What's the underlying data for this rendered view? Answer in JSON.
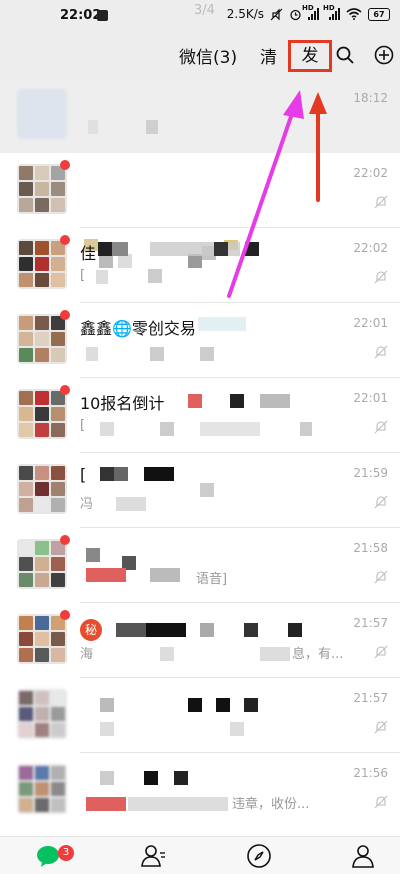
{
  "status_bar": {
    "time": "22:02",
    "page_indicator": "3/4",
    "net_speed": "2.5K/s",
    "sim1": "HD",
    "sim2": "HD",
    "battery": "67"
  },
  "header": {
    "title": "微信(3)",
    "clear_label": "清",
    "send_label": "发",
    "search_icon": "search-icon",
    "add_icon": "plus-circle-icon"
  },
  "chats": [
    {
      "name": "",
      "preview": "",
      "time": "18:12",
      "pinned": true,
      "unread_dot": false,
      "muted": false
    },
    {
      "name": "",
      "preview": "",
      "time": "22:02",
      "pinned": false,
      "unread_dot": true,
      "muted": true
    },
    {
      "name": "佳",
      "preview": "[",
      "time": "22:02",
      "pinned": false,
      "unread_dot": true,
      "muted": true
    },
    {
      "name": "鑫鑫🌐零创交易",
      "preview": "",
      "time": "22:01",
      "pinned": false,
      "unread_dot": true,
      "muted": true
    },
    {
      "name": "10报名倒计",
      "preview": "[",
      "time": "22:01",
      "pinned": false,
      "unread_dot": true,
      "muted": true
    },
    {
      "name": "[",
      "preview": "冯",
      "time": "21:59",
      "pinned": false,
      "unread_dot": false,
      "muted": true
    },
    {
      "name": "",
      "preview": "语音]",
      "time": "21:58",
      "pinned": false,
      "unread_dot": true,
      "muted": true
    },
    {
      "name": "秘",
      "preview": "海",
      "time": "21:57",
      "pinned": false,
      "unread_dot": true,
      "muted": true,
      "extra_preview": "息，有..."
    },
    {
      "name": "",
      "preview": "",
      "time": "21:57",
      "pinned": false,
      "unread_dot": false,
      "muted": true
    },
    {
      "name": "",
      "preview": "违章，收份...",
      "time": "21:56",
      "pinned": false,
      "unread_dot": false,
      "muted": true
    }
  ],
  "tabbar": {
    "chats_badge": "3"
  },
  "colors": {
    "accent_green": "#07c160",
    "badge_red": "#f23c3c",
    "annotation_red": "#e23a22",
    "annotation_magenta": "#e83be8"
  }
}
